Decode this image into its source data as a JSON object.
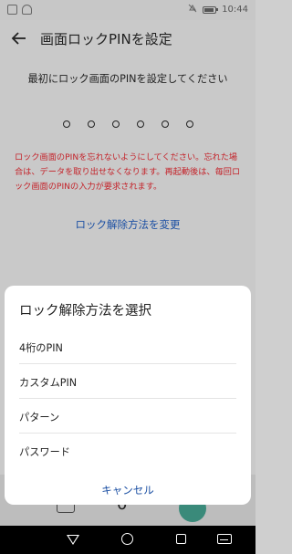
{
  "status_bar": {
    "time": "10:44"
  },
  "header": {
    "title": "画面ロックPINを設定"
  },
  "instruction": "最初にロック画面のPINを設定してください",
  "pin": {
    "length": 6
  },
  "warning": "ロック画面のPINを忘れないようにしてください。忘れた場合は、データを取り出せなくなります。再起動後は、毎回ロック画面のPINの入力が要求されます。",
  "change_method_link": "ロック解除方法を変更",
  "keyboard_peek": {
    "key_zero": "0"
  },
  "sheet": {
    "title": "ロック解除方法を選択",
    "options": [
      {
        "label": "4桁のPIN"
      },
      {
        "label": "カスタムPIN"
      },
      {
        "label": "パターン"
      },
      {
        "label": "パスワード"
      }
    ],
    "cancel_label": "キャンセル"
  },
  "colors": {
    "accent": "#1b4fa3",
    "warning": "#c4232a"
  },
  "icons": [
    "sim-icon",
    "wifi-icon",
    "mute-icon",
    "battery-icon",
    "back-arrow-icon",
    "nav-back-icon",
    "nav-home-icon",
    "nav-recent-icon",
    "nav-keyboard-icon"
  ]
}
